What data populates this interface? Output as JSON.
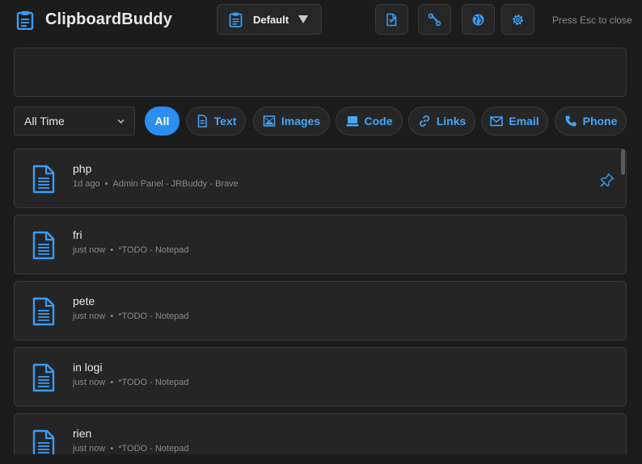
{
  "header": {
    "app_title": "ClipboardBuddy",
    "profile_label": "Default",
    "esc_hint": "Press Esc to close",
    "buttons": [
      {
        "name": "edit-button",
        "icon": "edit-note-icon"
      },
      {
        "name": "tools-button",
        "icon": "wrench-icon"
      },
      {
        "name": "sync-button",
        "icon": "globe-icon"
      },
      {
        "name": "settings-button",
        "icon": "gear-icon"
      }
    ]
  },
  "search": {
    "value": "",
    "placeholder": ""
  },
  "filters": {
    "time_range": "All Time",
    "chips": [
      {
        "label": "All",
        "active": true
      },
      {
        "label": "Text",
        "icon": "document-icon"
      },
      {
        "label": "Images",
        "icon": "image-icon"
      },
      {
        "label": "Code",
        "icon": "monitor-icon"
      },
      {
        "label": "Links",
        "icon": "link-icon"
      },
      {
        "label": "Email",
        "icon": "envelope-icon"
      },
      {
        "label": "Phone",
        "icon": "phone-icon"
      }
    ]
  },
  "items": [
    {
      "text": "php",
      "time": "1d ago",
      "source": "Admin Panel - JRBuddy - Brave",
      "pinned": true
    },
    {
      "text": "fri",
      "time": "just now",
      "source": "*TODO - Notepad"
    },
    {
      "text": "pete",
      "time": "just now",
      "source": "*TODO - Notepad"
    },
    {
      "text": "in logi",
      "time": "just now",
      "source": "*TODO - Notepad"
    },
    {
      "text": "rien",
      "time": "just now",
      "source": "*TODO - Notepad"
    }
  ],
  "colors": {
    "accent": "#2a8ff0",
    "accent_text": "#46a5f5",
    "background": "#1c1c1d",
    "card": "#252526",
    "muted": "#8a8a8a"
  }
}
